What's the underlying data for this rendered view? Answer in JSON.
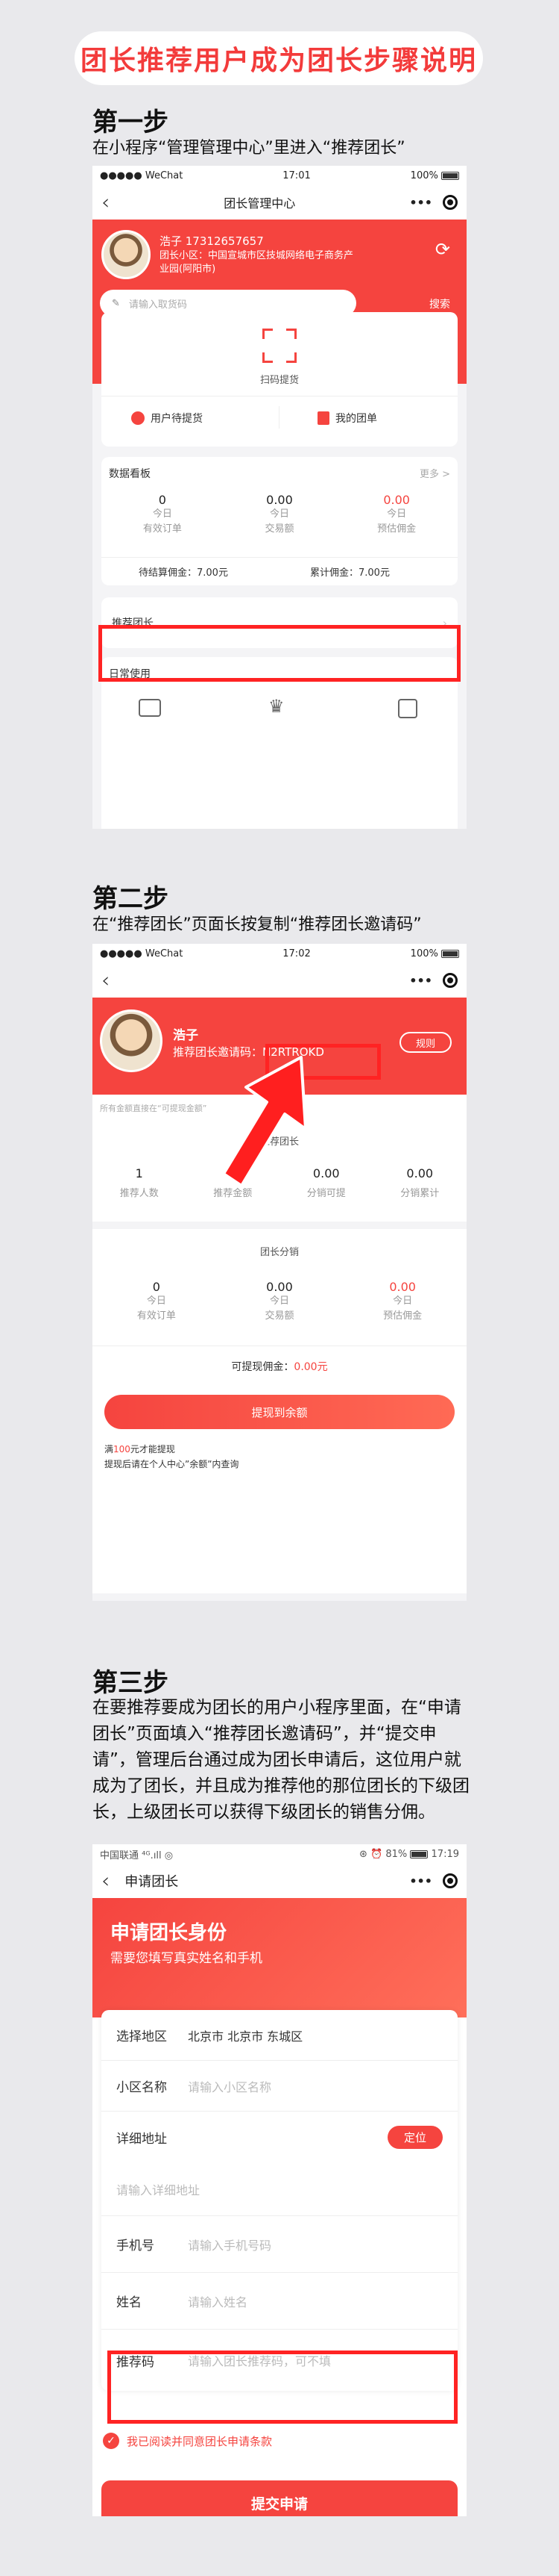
{
  "title": "团长推荐用户成为团长步骤说明",
  "step1": {
    "heading": "第一步",
    "desc": "在小程序“管理管理中心”里进入“推荐团长”",
    "status": {
      "carrier": "●●●●● WeChat",
      "time": "17:01",
      "battery": "100%"
    },
    "nav_title": "团长管理中心",
    "capsule_dots": "•••",
    "user_name_phone": "浩子  17312657657",
    "community": "团长小区：中国宣城市区技城网络电子商务产业园(阿阳市)",
    "search_placeholder": "请输入取货码",
    "search_btn": "搜索",
    "scan_label": "扫码提货",
    "pending_label": "用户待提货",
    "myorders_label": "我的团单",
    "board_title": "数据看板",
    "more": "更多 >",
    "stats": [
      {
        "value": "0",
        "l1": "今日",
        "l2": "有效订单"
      },
      {
        "value": "0.00",
        "l1": "今日",
        "l2": "交易额"
      },
      {
        "value": "0.00",
        "l1": "今日",
        "l2": "预估佣金"
      }
    ],
    "pending_commission": "待结算佣金：7.00元",
    "total_commission": "累计佣金：7.00元",
    "recommend": "推荐团长",
    "daily": "日常使用",
    "colors": {
      "accent": "#f5443f"
    }
  },
  "step2": {
    "heading": "第二步",
    "desc": "在“推荐团长”页面长按复制“推荐团长邀请码”",
    "status": {
      "carrier": "●●●●● WeChat",
      "time": "17:02",
      "battery": "100%"
    },
    "name": "浩子",
    "invite_label": "推荐团长邀请码",
    "invite_code": "：N2RTROKD",
    "rules": "规则",
    "notice": "所有金额直接在“可提现金额”",
    "section1_title": "推荐团长",
    "stats1": [
      {
        "value": "1",
        "label": "推荐人数"
      },
      {
        "value": "5",
        "label": "推荐金额"
      },
      {
        "value": "0.00",
        "label": "分销可提"
      },
      {
        "value": "0.00",
        "label": "分销累计"
      }
    ],
    "section2_title": "团长分销",
    "stats2": [
      {
        "value": "0",
        "l1": "今日",
        "l2": "有效订单"
      },
      {
        "value": "0.00",
        "l1": "今日",
        "l2": "交易额"
      },
      {
        "value": "0.00",
        "l1": "今日",
        "l2": "预估佣金"
      }
    ],
    "withdrawable_label": "可提现佣金：",
    "withdrawable_value": "0.00元",
    "withdraw_btn": "提现到余额",
    "tip_prefix": "满",
    "tip_amount": "100",
    "tip_suffix": "元才能提现",
    "tip2": "提现后请在个人中心”余额”内查询"
  },
  "step3": {
    "heading": "第三步",
    "desc": "在要推荐要成为团长的用户小程序里面，在“申请团长”页面填入“推荐团长邀请码”，并“提交申请”，管理后台通过成为团长申请后，这位用户就成为了团长，并且成为推荐他的那位团长的下级团长，上级团长可以获得下级团长的销售分佣。",
    "status": {
      "carrier": "中国联通 ⁴ᴳ.ıll ◎",
      "right": "⊛ ⏰ 81%",
      "time": "17:19"
    },
    "nav_title": "申请团长",
    "banner_title": "申请团长身份",
    "banner_sub": "需要您填写真实姓名和手机",
    "region_label": "选择地区",
    "region_value": "北京市 北京市 东城区",
    "community_label": "小区名称",
    "community_ph": "请输入小区名称",
    "address_label": "详细地址",
    "locate_btn": "定位",
    "address_ph": "请输入详细地址",
    "phone_label": "手机号",
    "phone_ph": "请输入手机号码",
    "name_label": "姓名",
    "name_ph": "请输入姓名",
    "ref_label": "推荐码",
    "ref_ph": "请输入团长推荐码，可不填",
    "agree": "我已阅读并同意团长申请条款",
    "submit": "提交申请"
  }
}
